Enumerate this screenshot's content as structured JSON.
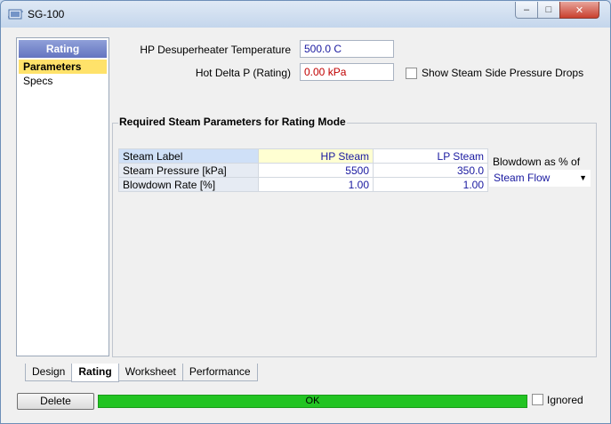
{
  "window": {
    "title": "SG-100",
    "min_glyph": "–",
    "max_glyph": "□",
    "close_glyph": "✕"
  },
  "nav": {
    "header": "Rating",
    "items": [
      {
        "label": "Parameters",
        "selected": true
      },
      {
        "label": "Specs",
        "selected": false
      }
    ]
  },
  "fields": {
    "hp_desuperheater_temp": {
      "label": "HP Desuperheater Temperature",
      "value": "500.0 C"
    },
    "hot_delta_p": {
      "label": "Hot Delta P (Rating)",
      "value": "0.00 kPa"
    },
    "show_steam_side": {
      "label": "Show Steam Side Pressure Drops",
      "checked": false
    }
  },
  "steam_group": {
    "title": "Required Steam Parameters for Rating Mode",
    "rows": [
      {
        "label": "Steam Label",
        "hp": "HP Steam",
        "lp": "LP Steam"
      },
      {
        "label": "Steam Pressure [kPa]",
        "hp": "5500",
        "lp": "350.0"
      },
      {
        "label": "Blowdown Rate [%]",
        "hp": "1.00",
        "lp": "1.00"
      }
    ],
    "blowdown_label": "Blowdown as % of",
    "blowdown_selected": "Steam Flow"
  },
  "tabs": [
    {
      "label": "Design",
      "active": false
    },
    {
      "label": "Rating",
      "active": true
    },
    {
      "label": "Worksheet",
      "active": false
    },
    {
      "label": "Performance",
      "active": false
    }
  ],
  "bottom": {
    "delete_label": "Delete",
    "status": "OK",
    "ignored_label": "Ignored",
    "ignored_checked": false
  },
  "colors": {
    "status_ok": "#22c422",
    "nav_selected": "#ffe26a",
    "value_blue": "#1a1aa0",
    "value_red": "#c00000"
  }
}
